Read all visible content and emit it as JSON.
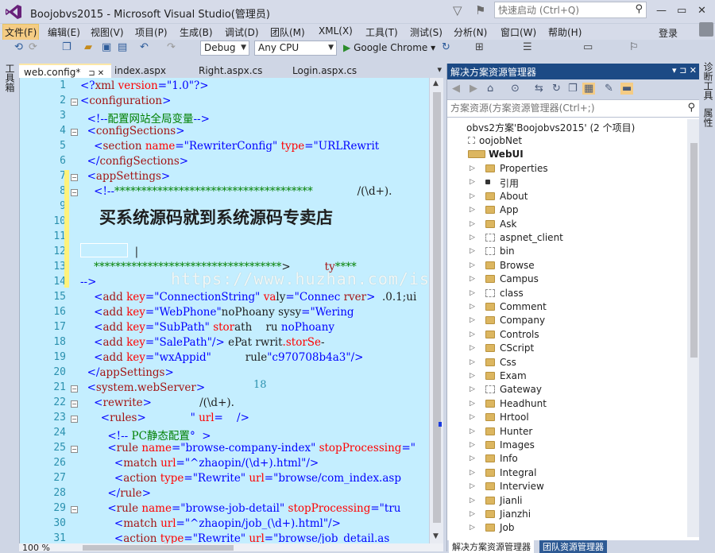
{
  "window": {
    "title": "Boojobvs2015 - Microsoft Visual Studio(管理员)",
    "quick_launch_placeholder": "快速启动 (Ctrl+Q)"
  },
  "menu": {
    "items": [
      "文件(F)",
      "编辑(E)",
      "视图(V)",
      "项目(P)",
      "生成(B)",
      "调试(D)",
      "团队(M)",
      "XML(X)",
      "工具(T)",
      "测试(S)",
      "分析(N)",
      "窗口(W)",
      "帮助(H)"
    ],
    "login": "登录"
  },
  "toolbar": {
    "config": "Debug",
    "platform": "Any CPU",
    "run_target": "Google Chrome"
  },
  "left_strip": {
    "label": "工具箱"
  },
  "right_strip": {
    "labels": [
      "诊断工具",
      "属性"
    ]
  },
  "editor": {
    "tabs": [
      {
        "label": "web.config*",
        "pin": "⊐ ✕"
      },
      {
        "label": "index.aspx"
      },
      {
        "label": "Right.aspx.cs"
      },
      {
        "label": "Login.aspx.cs"
      }
    ],
    "zoom": "100 %",
    "lines": [
      {
        "n": "1",
        "h": "<span class='b'>&lt;?</span><span class='m'>xml</span> <span class='r'>version</span><span class='b'>=\"</span><span class='b'>1.0</span><span class='b'>\"?&gt;</span>"
      },
      {
        "n": "2",
        "h": "<span class='b'>&lt;</span><span class='m'>configuration</span><span class='b'>&gt;</span>"
      },
      {
        "n": "3",
        "h": "  <span class='b'>&lt;!--</span><span class='c'>配置网站全局变量</span><span class='b'>--&gt;</span>"
      },
      {
        "n": "4",
        "h": "  <span class='b'>&lt;</span><span class='m'>configSections</span><span class='b'>&gt;</span>"
      },
      {
        "n": "5",
        "h": "    <span class='b'>&lt;</span><span class='m'>section</span> <span class='r'>name</span><span class='b'>=\"RewriterConfig\"</span> <span class='r'>type</span><span class='b'>=\"URLRewrit</span>"
      },
      {
        "n": "6",
        "h": "  <span class='b'>&lt;/</span><span class='m'>configSections</span><span class='b'>&gt;</span>"
      },
      {
        "n": "7",
        "h": "  <span class='b'>&lt;</span><span class='m'>appSettings</span><span class='b'>&gt;</span>"
      },
      {
        "n": "8",
        "h": "    <span class='b'>&lt;!--</span><span class='c'>*************************************</span>             <span class='k'>/(\\d+).</span>"
      },
      {
        "n": "9",
        "h": ""
      },
      {
        "n": "10",
        "h": ""
      },
      {
        "n": "11",
        "h": ""
      },
      {
        "n": "12",
        "h": "                <span class='k'>|</span>"
      },
      {
        "n": "13",
        "h": "    <span class='c'>***********************************</span><span class='k'>&gt;</span>          <span class='m'>ty</span><span class='c'>****</span>"
      },
      {
        "n": "14",
        "h": "<span class='b'>--&gt;</span>"
      },
      {
        "n": "15",
        "h": "    <span class='b'>&lt;</span><span class='m'>add</span> <span class='r'>key</span><span class='b'>=\"ConnectionString\"</span> <span class='r'>va</span><span class='k'>ly</span><span class='b'>=\"Connec</span> <span class='m'>rver</span><span class='b'>&gt;</span>  <span class='k'>.0.1;ui</span>"
      },
      {
        "n": "16",
        "h": "    <span class='b'>&lt;</span><span class='m'>add</span> <span class='r'>key</span><span class='b'>=\"WebPhone\"</span><span class='k'>noPhoany</span> <span class='k'>sysy</span><span class='b'>=\"Wering</span>"
      },
      {
        "n": "17",
        "h": "    <span class='b'>&lt;</span><span class='m'>add</span> <span class='r'>key</span><span class='b'>=\"SubPath\"</span> <span class='r'>stor</span><span class='k'>ath</span>    <span class='k'>ru</span> <span class='b'>noPhoany</span>"
      },
      {
        "n": "18",
        "h": "    <span class='b'>&lt;</span><span class='m'>add</span> <span class='r'>key</span><span class='b'>=\"SalePath\"</span><span class='b'>/&gt;</span> <span class='k'>ePat</span> <span class='k'>rwrit</span><span class='r'>.storSe</span><span class='k'>-</span>"
      },
      {
        "n": "19",
        "h": "    <span class='b'>&lt;</span><span class='m'>add</span> <span class='r'>key</span><span class='b'>=\"wxAppid\"</span>          <span class='k'>rule</span><span class='b'>\"c970708b4a3\"/&gt;</span>"
      },
      {
        "n": "20",
        "h": "  <span class='b'>&lt;/</span><span class='m'>appSettings</span><span class='b'>&gt;</span>"
      },
      {
        "n": "21",
        "h": "  <span class='b'>&lt;</span><span class='m'>system.webServer</span><span class='b'>&gt;</span>"
      },
      {
        "n": "22",
        "h": "    <span class='b'>&lt;</span><span class='m'>rewrite</span><span class='b'>&gt;</span>              <span class='k'>/(\\d+).</span>"
      },
      {
        "n": "23",
        "h": "      <span class='b'>&lt;</span><span class='m'>rules</span><span class='b'>&gt;</span>             <span class='b'>\"</span> <span class='r'>url</span><span class='b'>=</span>    <span class='b'>/&gt;</span>"
      },
      {
        "n": "24",
        "h": "        <span class='b'>&lt;!--</span> <span class='c'>PC静态配置</span><span class='b'>°</span>  <span class='b'>&gt;</span>"
      },
      {
        "n": "25",
        "h": "        <span class='b'>&lt;</span><span class='m'>rule</span> <span class='r'>name</span><span class='b'>=\"browse-company-index\"</span> <span class='r'>stopProcessing</span><span class='b'>=\"</span>"
      },
      {
        "n": "26",
        "h": "          <span class='b'>&lt;</span><span class='m'>match</span> <span class='r'>url</span><span class='b'>=\"^zhaopin/(\\d+).html\"/&gt;</span>"
      },
      {
        "n": "27",
        "h": "          <span class='b'>&lt;</span><span class='m'>action</span> <span class='r'>type</span><span class='b'>=\"Rewrite\"</span> <span class='r'>url</span><span class='b'>=\"browse/com_index.asp</span>"
      },
      {
        "n": "28",
        "h": "        <span class='b'>&lt;/</span><span class='m'>rule</span><span class='b'>&gt;</span>"
      },
      {
        "n": "29",
        "h": "        <span class='b'>&lt;</span><span class='m'>rule</span> <span class='r'>name</span><span class='b'>=\"browse-job-detail\"</span> <span class='r'>stopProcessing</span><span class='b'>=\"tru</span>"
      },
      {
        "n": "30",
        "h": "          <span class='b'>&lt;</span><span class='m'>match</span> <span class='r'>url</span><span class='b'>=\"^zhaopin/job_(\\d+).html\"/&gt;</span>"
      },
      {
        "n": "31",
        "h": "          <span class='b'>&lt;</span><span class='m'>action</span> <span class='r'>type</span><span class='b'>=\"Rewrite\"</span> <span class='r'>url</span><span class='b'>=\"browse/job_detail.as</span>"
      }
    ],
    "overlay_text": "买系统源码就到系统源码专卖店",
    "watermark": "https://www.huzhan.com/ishop14144",
    "stray_number": "18"
  },
  "solution_explorer": {
    "title": "解决方案资源管理器",
    "search_placeholder": "方案资源(方案资源管理器(Ctrl+;)",
    "solution_label": "obvs2方案'Boojobvs2015' (2 个项目)",
    "projects": [
      "oojobNet",
      "WebUI"
    ],
    "items": [
      {
        "label": "Properties",
        "kind": "special"
      },
      {
        "label": "引用",
        "kind": "ref"
      },
      {
        "label": "About",
        "kind": "folder"
      },
      {
        "label": "App",
        "kind": "folder"
      },
      {
        "label": "Ask",
        "kind": "folder"
      },
      {
        "label": "aspnet_client",
        "kind": "dotted"
      },
      {
        "label": "bin",
        "kind": "dotted"
      },
      {
        "label": "Browse",
        "kind": "folder"
      },
      {
        "label": "Campus",
        "kind": "folder"
      },
      {
        "label": "class",
        "kind": "dotted"
      },
      {
        "label": "Comment",
        "kind": "folder"
      },
      {
        "label": "Company",
        "kind": "folder"
      },
      {
        "label": "Controls",
        "kind": "folder"
      },
      {
        "label": "CScript",
        "kind": "folder"
      },
      {
        "label": "Css",
        "kind": "folder"
      },
      {
        "label": "Exam",
        "kind": "folder"
      },
      {
        "label": "Gateway",
        "kind": "dotted"
      },
      {
        "label": "Headhunt",
        "kind": "folder"
      },
      {
        "label": "Hrtool",
        "kind": "folder"
      },
      {
        "label": "Hunter",
        "kind": "folder"
      },
      {
        "label": "Images",
        "kind": "folder"
      },
      {
        "label": "Info",
        "kind": "folder"
      },
      {
        "label": "Integral",
        "kind": "folder"
      },
      {
        "label": "Interview",
        "kind": "folder"
      },
      {
        "label": "Jianli",
        "kind": "folder"
      },
      {
        "label": "Jianzhi",
        "kind": "folder"
      },
      {
        "label": "Job",
        "kind": "folder"
      }
    ],
    "bottom_tabs": [
      "解决方案资源管理器",
      "团队资源管理器"
    ]
  },
  "colors": {
    "editor_bg": "#c4eeff",
    "title_bar_active": "#1c4a85",
    "menu_active": "#f5cc84"
  }
}
